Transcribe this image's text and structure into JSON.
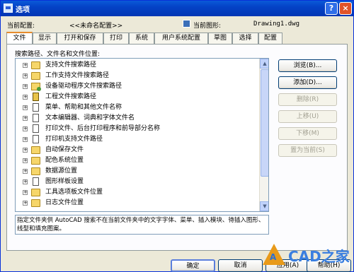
{
  "window": {
    "title": "选项",
    "help_btn": "?",
    "close_btn": "×"
  },
  "profile": {
    "current_profile_label": "当前配置:",
    "current_profile_value": "<<未命名配置>>",
    "current_drawing_label": "当前图形:",
    "current_drawing_value": "Drawing1.dwg"
  },
  "tabs": [
    "文件",
    "显示",
    "打开和保存",
    "打印",
    "系统",
    "用户系统配置",
    "草图",
    "选择",
    "配置"
  ],
  "section_label": "搜索路径、文件名和文件位置:",
  "tree_items": [
    {
      "label": "支持文件搜索路径",
      "icon": "folder-icon"
    },
    {
      "label": "工作支持文件搜索路径",
      "icon": "folder-icon"
    },
    {
      "label": "设备驱动程序文件搜索路径",
      "icon": "folder-gear-icon"
    },
    {
      "label": "工程文件搜索路径",
      "icon": "book-icon"
    },
    {
      "label": "菜单、帮助和其他文件名称",
      "icon": "document-icon"
    },
    {
      "label": "文本编辑器、词典和字体文件名",
      "icon": "document-icon"
    },
    {
      "label": "打印文件、后台打印程序和前导部分名称",
      "icon": "document-icon"
    },
    {
      "label": "打印机支持文件路径",
      "icon": "document-icon"
    },
    {
      "label": "自动保存文件",
      "icon": "folder-icon"
    },
    {
      "label": "配色系统位置",
      "icon": "folder-icon"
    },
    {
      "label": "数据源位置",
      "icon": "folder-icon"
    },
    {
      "label": "图形样板设置",
      "icon": "document-icon"
    },
    {
      "label": "工具选项板文件位置",
      "icon": "folder-icon"
    },
    {
      "label": "日志文件位置",
      "icon": "folder-icon"
    }
  ],
  "description": "指定文件夹供 AutoCAD 搜索不在当前文件夹中的文字字体、菜单、插入模块、待插入图形、线型和填充图案。",
  "side_buttons": [
    "浏览(B)...",
    "添加(D)...",
    "删除(R)",
    "上移(U)",
    "下移(M)",
    "置为当前(S)"
  ],
  "bottom_buttons": [
    "确定",
    "取消",
    "应用(A)",
    "帮助(H)"
  ],
  "watermark": {
    "text": "CAD之家"
  }
}
